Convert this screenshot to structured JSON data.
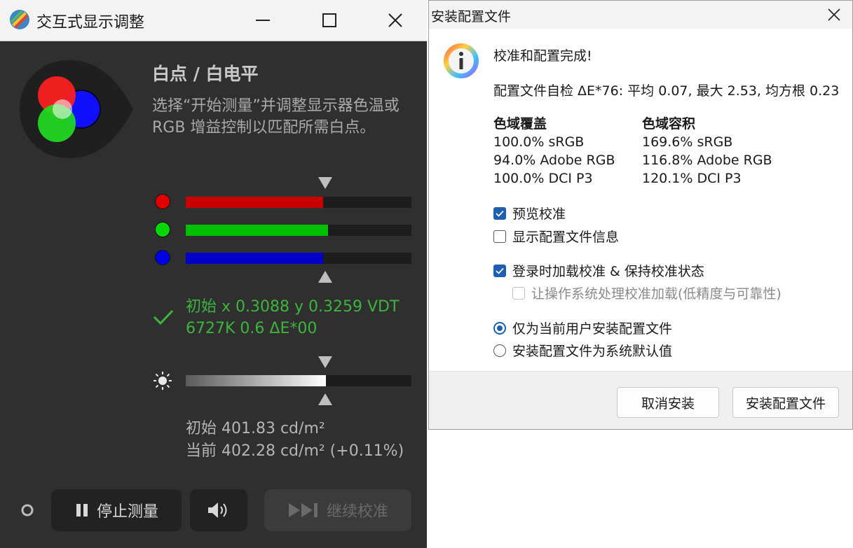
{
  "left_window": {
    "title": "交互式显示调整",
    "section_title": "白点 / 白电平",
    "description": "选择“开始测量”并调整显示器色温或 RGB 增益控制以匹配所需白点。",
    "channels": [
      {
        "name": "red",
        "color": "#e00000",
        "fill": 0.61
      },
      {
        "name": "green",
        "color": "#00d800",
        "fill": 0.63
      },
      {
        "name": "blue",
        "color": "#0000e0",
        "fill": 0.61
      }
    ],
    "status_line1": "初始 x 0.3088 y 0.3259 VDT",
    "status_line2": "6727K 0.6 ΔE*00",
    "luminance_fill": 0.62,
    "luminance_initial": "初始 401.83 cd/m²",
    "luminance_current": "当前 402.28 cd/m² (+0.11%)",
    "buttons": {
      "stop": "停止测量",
      "continue": "继续校准"
    },
    "icons": {
      "app": "displaycal-logo-icon",
      "minimize": "minimize-icon",
      "maximize": "maximize-icon",
      "close": "close-icon",
      "check": "check-icon",
      "sun": "brightness-icon",
      "sound": "speaker-icon",
      "pause": "pause-icon",
      "skip": "skip-forward-icon"
    }
  },
  "dialog": {
    "title": "安装配置文件",
    "heading": "校准和配置完成!",
    "selftest": "配置文件自检 ΔE*76: 平均 0.07, 最大 2.53, 均方根 0.23",
    "gamut_coverage": {
      "header": "色域覆盖",
      "rows": [
        "100.0% sRGB",
        "94.0% Adobe RGB",
        "100.0% DCI P3"
      ]
    },
    "gamut_volume": {
      "header": "色域容积",
      "rows": [
        "169.6% sRGB",
        "116.8% Adobe RGB",
        "120.1% DCI P3"
      ]
    },
    "options": {
      "preview": {
        "label": "预览校准",
        "checked": true
      },
      "show_info": {
        "label": "显示配置文件信息",
        "checked": false
      },
      "load_on_login": {
        "label": "登录时加载校准 & 保持校准状态",
        "checked": true
      },
      "os_loading": {
        "label": "让操作系统处理校准加载(低精度与可靠性)",
        "checked": false,
        "disabled": true
      }
    },
    "install_scope": {
      "current_user": "仅为当前用户安装配置文件",
      "system_default": "安装配置文件为系统默认值",
      "selected": "current_user"
    },
    "buttons": {
      "cancel": "取消安装",
      "install": "安装配置文件"
    },
    "colors": {
      "accent": "#1f5fb0"
    }
  }
}
